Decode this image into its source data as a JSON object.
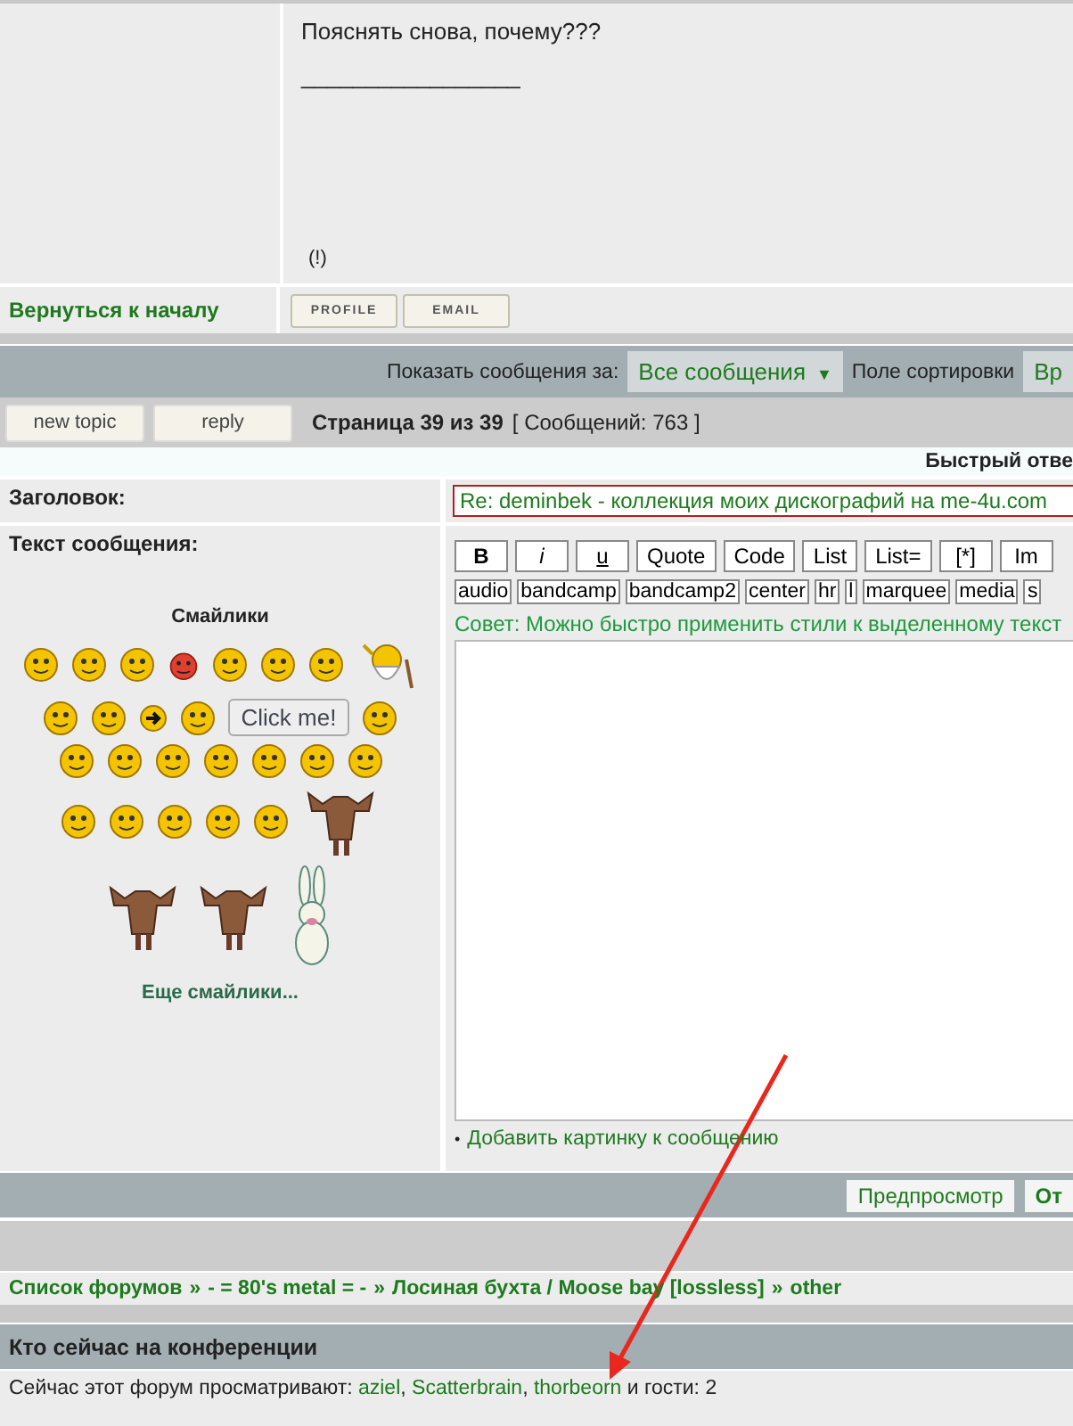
{
  "post": {
    "body_lines": [
      "Пояснять снова, почему???",
      "_________________"
    ],
    "report_mark": "(!)"
  },
  "post_footer": {
    "back_link": "Вернуться к началу",
    "buttons": [
      "PROFILE",
      "EMAIL"
    ]
  },
  "sort_bar": {
    "show_label": "Показать сообщения за:",
    "show_value": "Все сообщения",
    "dropdown_caret": "▼",
    "sort_label": "Поле сортировки",
    "sort_value": "Вр"
  },
  "action_bar": {
    "buttons": [
      "new topic",
      "reply"
    ],
    "page": "Страница 39 из 39",
    "count": "[ Сообщений: 763 ]"
  },
  "quick_reply": {
    "heading": "Быстрый отве",
    "subject_label": "Заголовок:",
    "subject_value": "Re: deminbek - коллекция моих дискографий на me-4u.com",
    "message_label": "Текст сообщения:",
    "smilies_title": "Смайлики",
    "smilies": [
      [
        {
          "kind": "face"
        },
        {
          "kind": "face"
        },
        {
          "kind": "face"
        },
        {
          "kind": "devil"
        },
        {
          "kind": "face"
        },
        {
          "kind": "face"
        },
        {
          "kind": "face"
        },
        {
          "kind": "wizard"
        }
      ],
      [
        {
          "kind": "face"
        },
        {
          "kind": "face"
        },
        {
          "kind": "arrow"
        },
        {
          "kind": "face"
        },
        {
          "kind": "button",
          "label": "Click me!"
        },
        {
          "kind": "face"
        }
      ],
      [
        {
          "kind": "face"
        },
        {
          "kind": "face"
        },
        {
          "kind": "face"
        },
        {
          "kind": "face"
        },
        {
          "kind": "face"
        },
        {
          "kind": "face"
        },
        {
          "kind": "face"
        }
      ],
      [
        {
          "kind": "face"
        },
        {
          "kind": "face"
        },
        {
          "kind": "face"
        },
        {
          "kind": "face"
        },
        {
          "kind": "face"
        },
        {
          "kind": "moose"
        }
      ],
      [
        {
          "kind": "moose"
        },
        {
          "kind": "moose"
        },
        {
          "kind": "bunny"
        }
      ]
    ],
    "more_smilies": "Еще смайлики...",
    "format_buttons": [
      {
        "label": "B",
        "kind": "bold"
      },
      {
        "label": "i",
        "kind": "italic"
      },
      {
        "label": "u",
        "kind": "underline"
      },
      {
        "label": "Quote",
        "kind": "plain"
      },
      {
        "label": "Code",
        "kind": "plain"
      },
      {
        "label": "List",
        "kind": "plain"
      },
      {
        "label": "List=",
        "kind": "plain"
      },
      {
        "label": "[*]",
        "kind": "plain"
      },
      {
        "label": "Im",
        "kind": "plain"
      }
    ],
    "tag_buttons": [
      "audio",
      "bandcamp",
      "bandcamp2",
      "center",
      "hr",
      "l",
      "marquee",
      "media",
      "s"
    ],
    "tip": "Совет: Можно быстро применить стили к выделенному текст",
    "bullet": "•",
    "add_image": "Добавить картинку к сообщению"
  },
  "submit_bar": {
    "buttons": [
      {
        "label": "Предпросмотр",
        "primary": false
      },
      {
        "label": "От",
        "primary": true
      }
    ]
  },
  "breadcrumbs": {
    "separator": "»",
    "items": [
      "Список форумов",
      "- = 80's metal = -",
      "Лосиная бухта / Moose bay [lossless]",
      "other"
    ]
  },
  "online": {
    "title": "Кто сейчас на конференции",
    "prefix": "Сейчас этот форум просматривают:",
    "separator": ",",
    "users": [
      "aziel",
      "Scatterbrain",
      "thorbeorn"
    ],
    "suffix": "и гости: 2"
  }
}
